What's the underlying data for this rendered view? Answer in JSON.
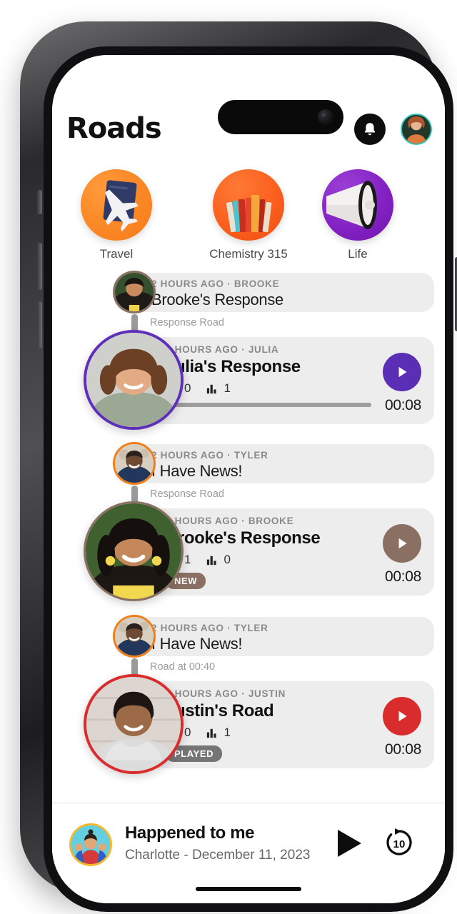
{
  "app": {
    "logo": "Roads",
    "bell_icon": "bell-icon",
    "avatar_icon": "user-avatar"
  },
  "stories": [
    {
      "label": "Travel",
      "icon": "airplane-passport-icon",
      "color": "#f77b18"
    },
    {
      "label": "Chemistry 315",
      "icon": "books-icon",
      "color": "#ef4f13"
    },
    {
      "label": "Life",
      "icon": "megaphone-icon",
      "color": "#6f14ab"
    }
  ],
  "feed": [
    {
      "parent": {
        "meta_time": "2 HOURS AGO",
        "meta_sep": "·",
        "meta_user": "BROOKE",
        "title": "Brooke's Response"
      },
      "connector": "Response Road",
      "child": {
        "meta_time": "2 HOURS AGO",
        "meta_sep": "·",
        "meta_user": "JULIA",
        "title": "Julia's Response",
        "shares": "0",
        "plays": "1",
        "badge": "",
        "duration": "00:08",
        "play_color": "#5a2fb5",
        "ring_color": "#5e2fb8"
      }
    },
    {
      "parent": {
        "meta_time": "2 HOURS AGO",
        "meta_sep": "·",
        "meta_user": "TYLER",
        "title": "I Have News!"
      },
      "connector": "Response Road",
      "child": {
        "meta_time": "2 HOURS AGO",
        "meta_sep": "·",
        "meta_user": "BROOKE",
        "title": "Brooke's Response",
        "shares": "1",
        "plays": "0",
        "badge": "NEW",
        "duration": "00:08",
        "play_color": "#8a6f63",
        "ring_color": "#8a6f63"
      }
    },
    {
      "parent": {
        "meta_time": "2 HOURS AGO",
        "meta_sep": "·",
        "meta_user": "TYLER",
        "title": "I Have News!"
      },
      "connector": "Road at 00:40",
      "child": {
        "meta_time": "2 HOURS AGO",
        "meta_sep": "·",
        "meta_user": "JUSTIN",
        "title": "Justin's Road",
        "shares": "0",
        "plays": "1",
        "badge": "PLAYED",
        "duration": "00:08",
        "play_color": "#d92d2d",
        "ring_color": "#d92d2d"
      }
    }
  ],
  "player": {
    "title": "Happened to me",
    "subtitle": "Charlotte - December 11, 2023",
    "play_icon": "play-icon",
    "skip_icon": "skip-forward-10-icon",
    "skip_seconds": "10"
  }
}
